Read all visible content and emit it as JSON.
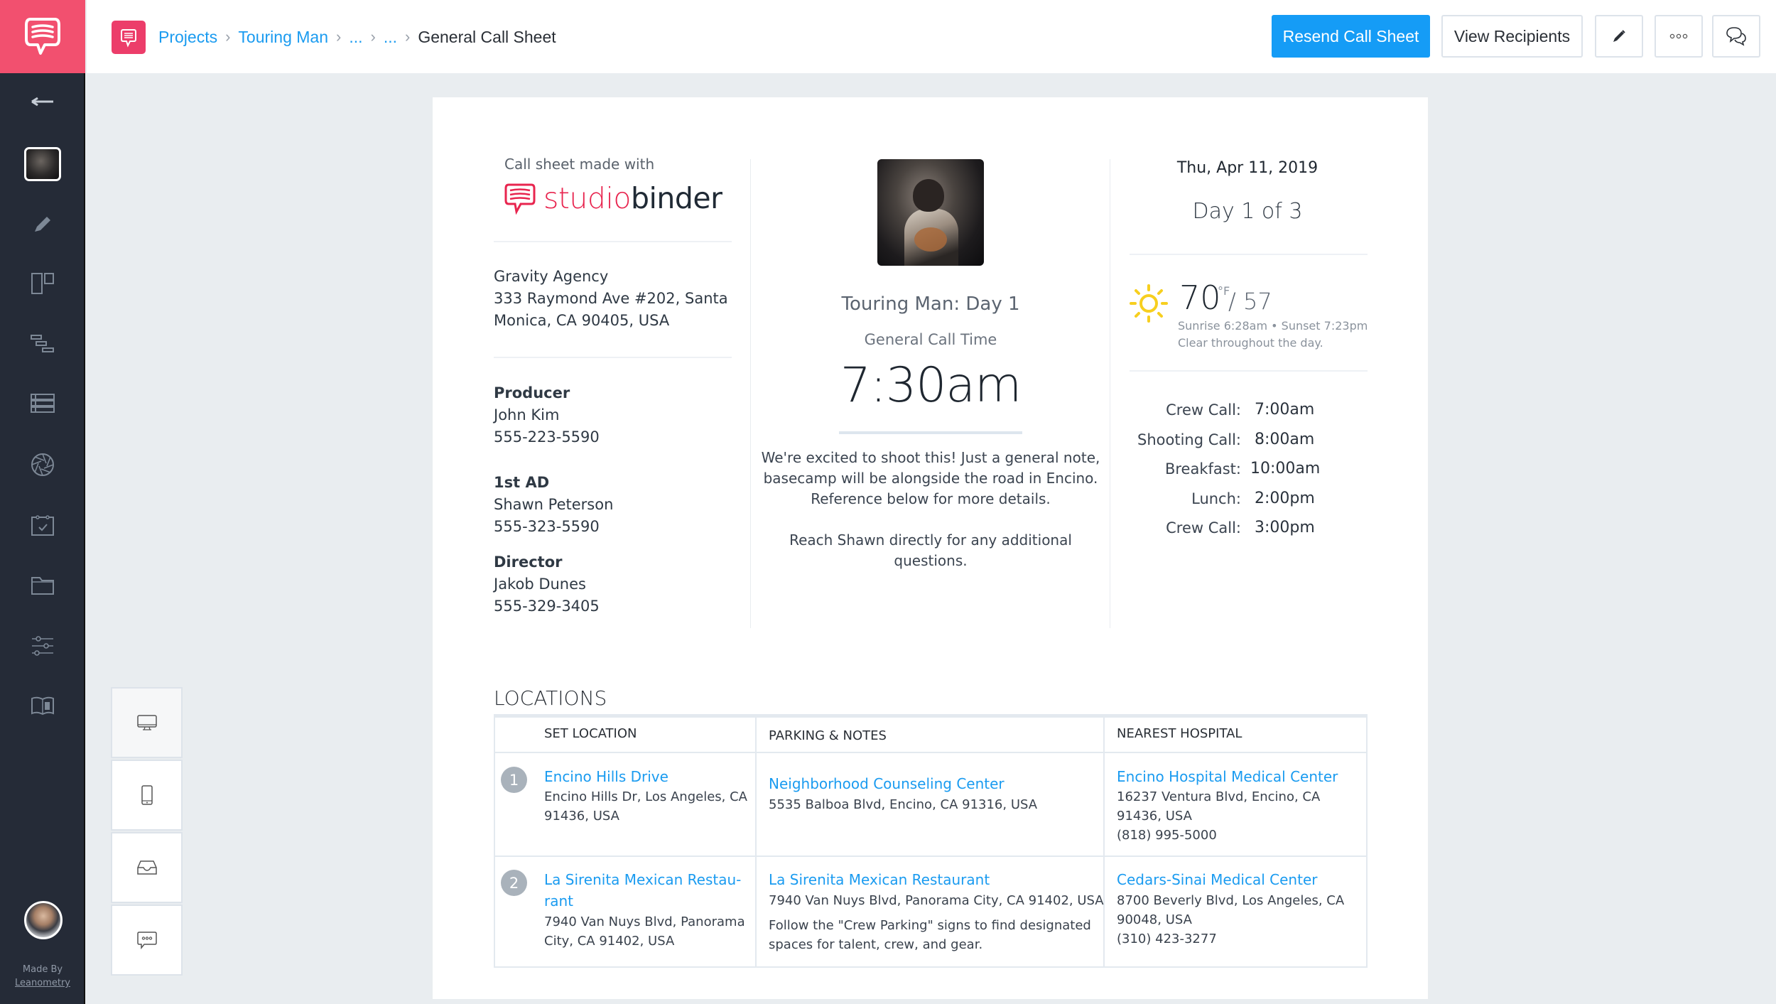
{
  "app": {
    "brand_color": "#f2506f",
    "accent_color": "#159cf6",
    "link_color": "#1a9bf0"
  },
  "sidebar": {
    "items": [
      {
        "name": "back",
        "icon": "arrow-left-icon"
      },
      {
        "name": "project-thumbnail",
        "icon": "project-thumbnail"
      },
      {
        "name": "write",
        "icon": "pencil-icon"
      },
      {
        "name": "boards",
        "icon": "board-icon"
      },
      {
        "name": "schedule",
        "icon": "stripboard-icon"
      },
      {
        "name": "lists",
        "icon": "list-icon"
      },
      {
        "name": "shots",
        "icon": "aperture-icon"
      },
      {
        "name": "calendar",
        "icon": "calendar-check-icon"
      },
      {
        "name": "files",
        "icon": "folder-icon"
      },
      {
        "name": "settings",
        "icon": "sliders-icon"
      },
      {
        "name": "guide",
        "icon": "book-info-icon"
      }
    ],
    "made_by_label": "Made By",
    "made_by_link": "Leanometry"
  },
  "breadcrumb": {
    "items": [
      "Projects",
      "Touring Man",
      "...",
      "..."
    ],
    "current": "General Call Sheet"
  },
  "toolbar": {
    "resend_label": "Resend Call Sheet",
    "recipients_label": "View Recipients",
    "edit_icon": "pencil-icon",
    "more_icon": "more-icon",
    "comments_icon": "comments-icon"
  },
  "call_sheet": {
    "made_with": "Call sheet made with",
    "logo_studio": "studio",
    "logo_binder": "binder",
    "company": {
      "name": "Gravity Agency",
      "address_line1": "333 Raymond Ave #202, Santa",
      "address_line2": "Monica, CA 90405, USA"
    },
    "contacts": [
      {
        "role": "Producer",
        "name": "John Kim",
        "phone": "555-223-5590"
      },
      {
        "role": "1st AD",
        "name": "Shawn Peterson",
        "phone": "555-323-5590"
      },
      {
        "role": "Director",
        "name": "Jakob Dunes",
        "phone": "555-329-3405"
      }
    ],
    "project_title": "Touring Man: Day 1",
    "general_call_label": "General Call Time",
    "general_call_time": "7:30am",
    "note_paragraph1": "We're excited to shoot this! Just a general note, basecamp will be alongside the road in Encino. Reference below for more details.",
    "note_paragraph2": "Reach Shawn directly for any additional questions.",
    "date": "Thu, Apr 11, 2019",
    "day_of": "Day 1 of 3",
    "weather": {
      "icon": "sun-icon",
      "high": "70",
      "unit": "°F",
      "low": "/ 57",
      "sun_times": "Sunrise 6:28am • Sunset 7:23pm",
      "summary": "Clear throughout the day."
    },
    "schedule": [
      {
        "label": "Crew Call:",
        "time": "7:00am"
      },
      {
        "label": "Shooting Call:",
        "time": "8:00am"
      },
      {
        "label": "Breakfast:",
        "time": "10:00am"
      },
      {
        "label": "Lunch:",
        "time": "2:00pm"
      },
      {
        "label": "Crew Call:",
        "time": "3:00pm"
      }
    ]
  },
  "locations": {
    "title": "LOCATIONS",
    "headers": [
      "SET LOCATION",
      "PARKING & NOTES",
      "NEAREST HOSPITAL"
    ],
    "rows": [
      {
        "number": "1",
        "set_name": "Encino Hills Drive",
        "set_address1": "Encino Hills Dr, Los Angeles, CA",
        "set_address2": "91436, USA",
        "parking_name": "Neighborhood Counseling Center",
        "parking_address": "5535 Balboa Blvd, Encino, CA 91316, USA",
        "parking_note1": "",
        "parking_note2": "",
        "hospital_name": "Encino Hospital Medical Center",
        "hospital_address1": "16237 Ventura Blvd, Encino, CA",
        "hospital_address2": "91436, USA",
        "hospital_phone": "(818) 995-5000"
      },
      {
        "number": "2",
        "set_name1": "La Sirenita Mexican Restau-",
        "set_name2": "rant",
        "set_address1": "7940 Van Nuys Blvd, Panorama",
        "set_address2": "City, CA 91402, USA",
        "parking_name": "La Sirenita Mexican Restaurant",
        "parking_address": "7940 Van Nuys Blvd, Panorama City, CA 91402, USA",
        "parking_note1": "Follow the \"Crew Parking\" signs to find designated",
        "parking_note2": "spaces for talent, crew, and gear.",
        "hospital_name": "Cedars-Sinai Medical Center",
        "hospital_address1": "8700 Beverly Blvd, Los Angeles, CA",
        "hospital_address2": "90048, USA",
        "hospital_phone": "(310) 423-3277"
      }
    ]
  },
  "device_preview": {
    "items": [
      {
        "name": "desktop",
        "icon": "desktop-icon",
        "active": true
      },
      {
        "name": "mobile",
        "icon": "mobile-icon",
        "active": false
      },
      {
        "name": "inbox",
        "icon": "inbox-icon",
        "active": false
      },
      {
        "name": "sms",
        "icon": "sms-icon",
        "active": false
      }
    ]
  }
}
